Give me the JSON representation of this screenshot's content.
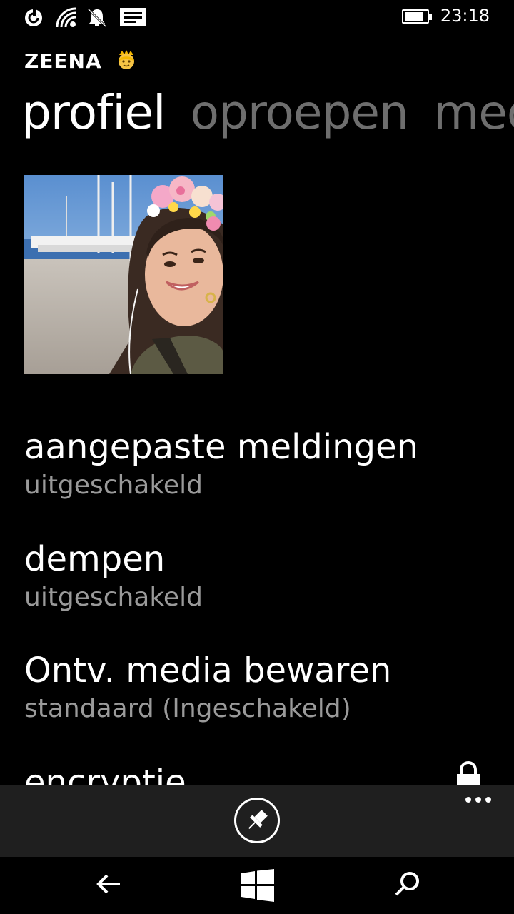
{
  "status_bar": {
    "time": "23:18",
    "battery_level": 0.85,
    "icons": [
      "data-sense-icon",
      "wifi-icon",
      "quiet-hours-icon",
      "message-icon",
      "battery-icon"
    ]
  },
  "header": {
    "contact_name": "ZEENA",
    "contact_emoji": "👸"
  },
  "pivot": {
    "tabs": [
      {
        "label": "profiel",
        "active": true
      },
      {
        "label": "oproepen",
        "active": false
      },
      {
        "label": "media",
        "active": false
      }
    ]
  },
  "settings": [
    {
      "title": "aangepaste meldingen",
      "subtitle": "uitgeschakeld"
    },
    {
      "title": "dempen",
      "subtitle": "uitgeschakeld"
    },
    {
      "title": "Ontv. media bewaren",
      "subtitle": "standaard (Ingeschakeld)"
    },
    {
      "title": "encryptie",
      "subtitle": ""
    }
  ],
  "app_bar": {
    "buttons": [
      "pin-icon",
      "more-icon"
    ]
  },
  "nav_bar": {
    "buttons": [
      "back-icon",
      "windows-start-icon",
      "search-icon"
    ]
  },
  "colors": {
    "background": "#000000",
    "inactive_tab": "#6e6e6e",
    "subtitle": "#9a9a9a",
    "app_bar": "#1f1f1f"
  }
}
